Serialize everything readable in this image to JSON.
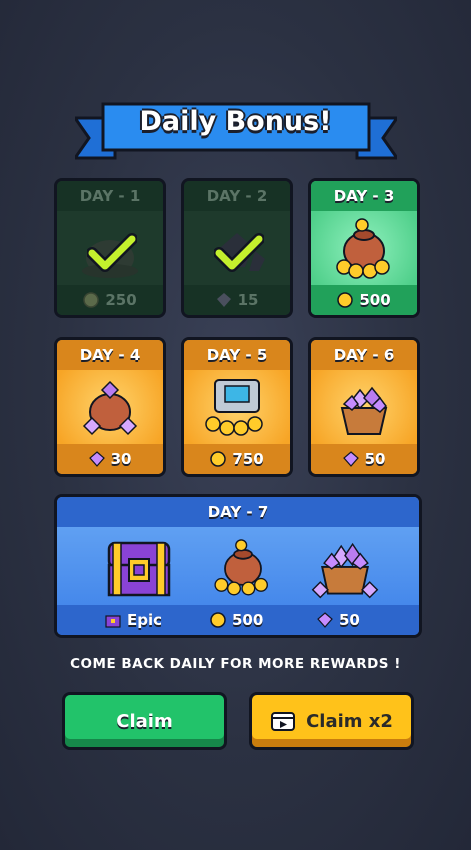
{
  "title": "Daily Bonus!",
  "days": [
    {
      "label": "DAY - 1",
      "amount": "250",
      "icon": "coin-icon",
      "state": "claimed"
    },
    {
      "label": "DAY - 2",
      "amount": "15",
      "icon": "gem-icon",
      "state": "claimed"
    },
    {
      "label": "DAY - 3",
      "amount": "500",
      "icon": "coin-icon",
      "state": "today"
    },
    {
      "label": "DAY - 4",
      "amount": "30",
      "icon": "gem-icon",
      "state": "future"
    },
    {
      "label": "DAY - 5",
      "amount": "750",
      "icon": "coin-icon",
      "state": "future"
    },
    {
      "label": "DAY - 6",
      "amount": "50",
      "icon": "gem-icon",
      "state": "future"
    }
  ],
  "day7": {
    "label": "DAY - 7",
    "rewards": [
      {
        "amount": "Epic",
        "icon": "chest-icon"
      },
      {
        "amount": "500",
        "icon": "coin-icon"
      },
      {
        "amount": "50",
        "icon": "gem-icon"
      }
    ]
  },
  "tagline": "COME BACK DAILY FOR MORE REWARDS !",
  "buttons": {
    "claim": "Claim",
    "claim_x2": "Claim x2"
  },
  "colors": {
    "claimed": "#1e3a2c",
    "today": "#4fcf8a",
    "future": "#f7a526",
    "day7": "#3b7fe8",
    "claim": "#22c36a",
    "claim_x2": "#ffc21a"
  }
}
